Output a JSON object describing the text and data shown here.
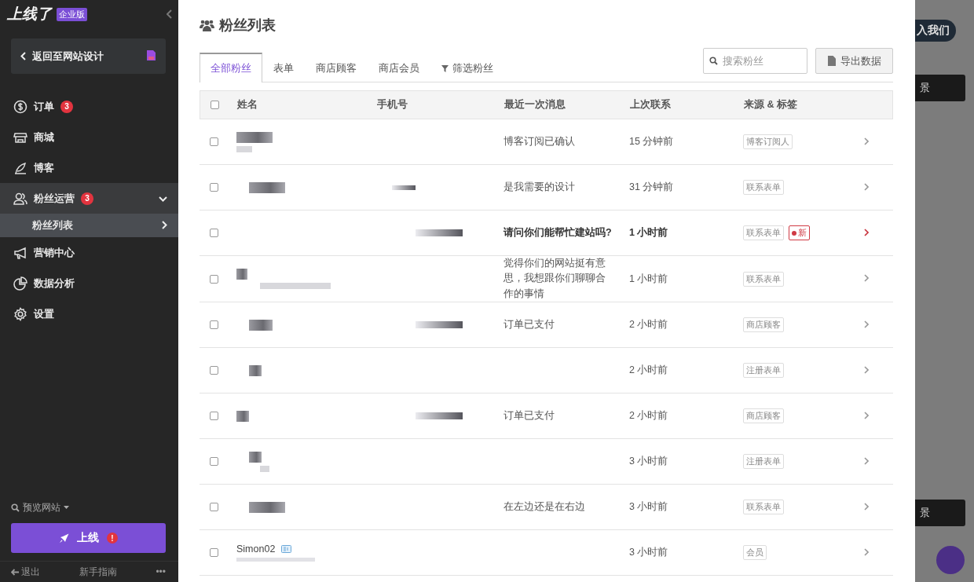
{
  "sidebar": {
    "logo": "上线了",
    "edition": "企业版",
    "back_button": "返回至网站设计",
    "items": [
      {
        "label": "订单",
        "badge": "3",
        "selected": false,
        "expanded": false
      },
      {
        "label": "商城",
        "selected": false,
        "expanded": false
      },
      {
        "label": "博客",
        "selected": false,
        "expanded": false
      },
      {
        "label": "粉丝运营",
        "badge": "3",
        "selected": false,
        "expanded": true,
        "children": [
          {
            "label": "粉丝列表",
            "selected": true
          }
        ]
      },
      {
        "label": "营销中心",
        "selected": false,
        "expanded": false
      },
      {
        "label": "数据分析",
        "selected": false,
        "expanded": false
      },
      {
        "label": "设置",
        "selected": false,
        "expanded": false
      }
    ],
    "preview": "预览网站",
    "publish_button": "上线",
    "publish_alert": "!",
    "footer": {
      "logout": "退出",
      "guide": "新手指南",
      "more": "•••"
    }
  },
  "panel": {
    "title": "粉丝列表",
    "tabs": [
      {
        "label": "全部粉丝",
        "kind": "tab",
        "selected": true
      },
      {
        "label": "表单",
        "kind": "tab",
        "selected": false
      },
      {
        "label": "商店顾客",
        "kind": "tab",
        "selected": false
      },
      {
        "label": "商店会员",
        "kind": "tab",
        "selected": false
      },
      {
        "label": "筛选粉丝",
        "kind": "filter",
        "selected": false
      }
    ],
    "search": {
      "placeholder": "搜索粉丝"
    },
    "export_button": "导出数据",
    "table": {
      "header_checked": false,
      "columns": [
        "姓名",
        "手机号",
        "最近一次消息",
        "上次联系",
        "来源 & 标签"
      ],
      "rows": [
        {
          "kind": "redacted",
          "checked": false,
          "message": "博客订阅已确认",
          "time": "15 分钟前",
          "unread": false,
          "tags": [
            {
              "label": "博客订阅人",
              "kind": "source"
            }
          ]
        },
        {
          "kind": "redacted",
          "checked": false,
          "message": "是我需要的设计",
          "time": "31 分钟前",
          "unread": false,
          "tags": [
            {
              "label": "联系表单",
              "kind": "source"
            }
          ]
        },
        {
          "kind": "redacted",
          "checked": false,
          "message": "请问你们能帮忙建站吗?",
          "time": "1 小时前",
          "unread": true,
          "tags": [
            {
              "label": "联系表单",
              "kind": "source"
            },
            {
              "label": "新",
              "kind": "new"
            }
          ]
        },
        {
          "kind": "redacted",
          "checked": false,
          "message": "觉得你们的网站挺有意思，我想跟你们聊聊合作的事情",
          "time": "1 小时前",
          "unread": false,
          "tags": [
            {
              "label": "联系表单",
              "kind": "source"
            }
          ]
        },
        {
          "kind": "redacted",
          "checked": false,
          "message": "订单已支付",
          "time": "2 小时前",
          "unread": false,
          "tags": [
            {
              "label": "商店顾客",
              "kind": "source"
            }
          ]
        },
        {
          "kind": "redacted",
          "checked": false,
          "time": "2 小时前",
          "unread": false,
          "tags": [
            {
              "label": "注册表单",
              "kind": "source"
            }
          ]
        },
        {
          "kind": "redacted",
          "checked": false,
          "message": "订单已支付",
          "time": "2 小时前",
          "unread": false,
          "tags": [
            {
              "label": "商店顾客",
              "kind": "source"
            }
          ]
        },
        {
          "kind": "redacted",
          "checked": false,
          "time": "3 小时前",
          "unread": false,
          "tags": [
            {
              "label": "注册表单",
              "kind": "source"
            }
          ]
        },
        {
          "kind": "redacted",
          "checked": false,
          "message": "在左边还是在右边",
          "time": "3 小时前",
          "unread": false,
          "tags": [
            {
              "label": "联系表单",
              "kind": "source"
            }
          ]
        },
        {
          "kind": "member",
          "name": "Simon02",
          "checked": false,
          "time": "3 小时前",
          "unread": false,
          "tags": [
            {
              "label": "会员",
              "kind": "source"
            }
          ]
        }
      ]
    }
  },
  "backdrop": {
    "join_button": "入我们",
    "banners": [
      "景",
      "景"
    ]
  }
}
